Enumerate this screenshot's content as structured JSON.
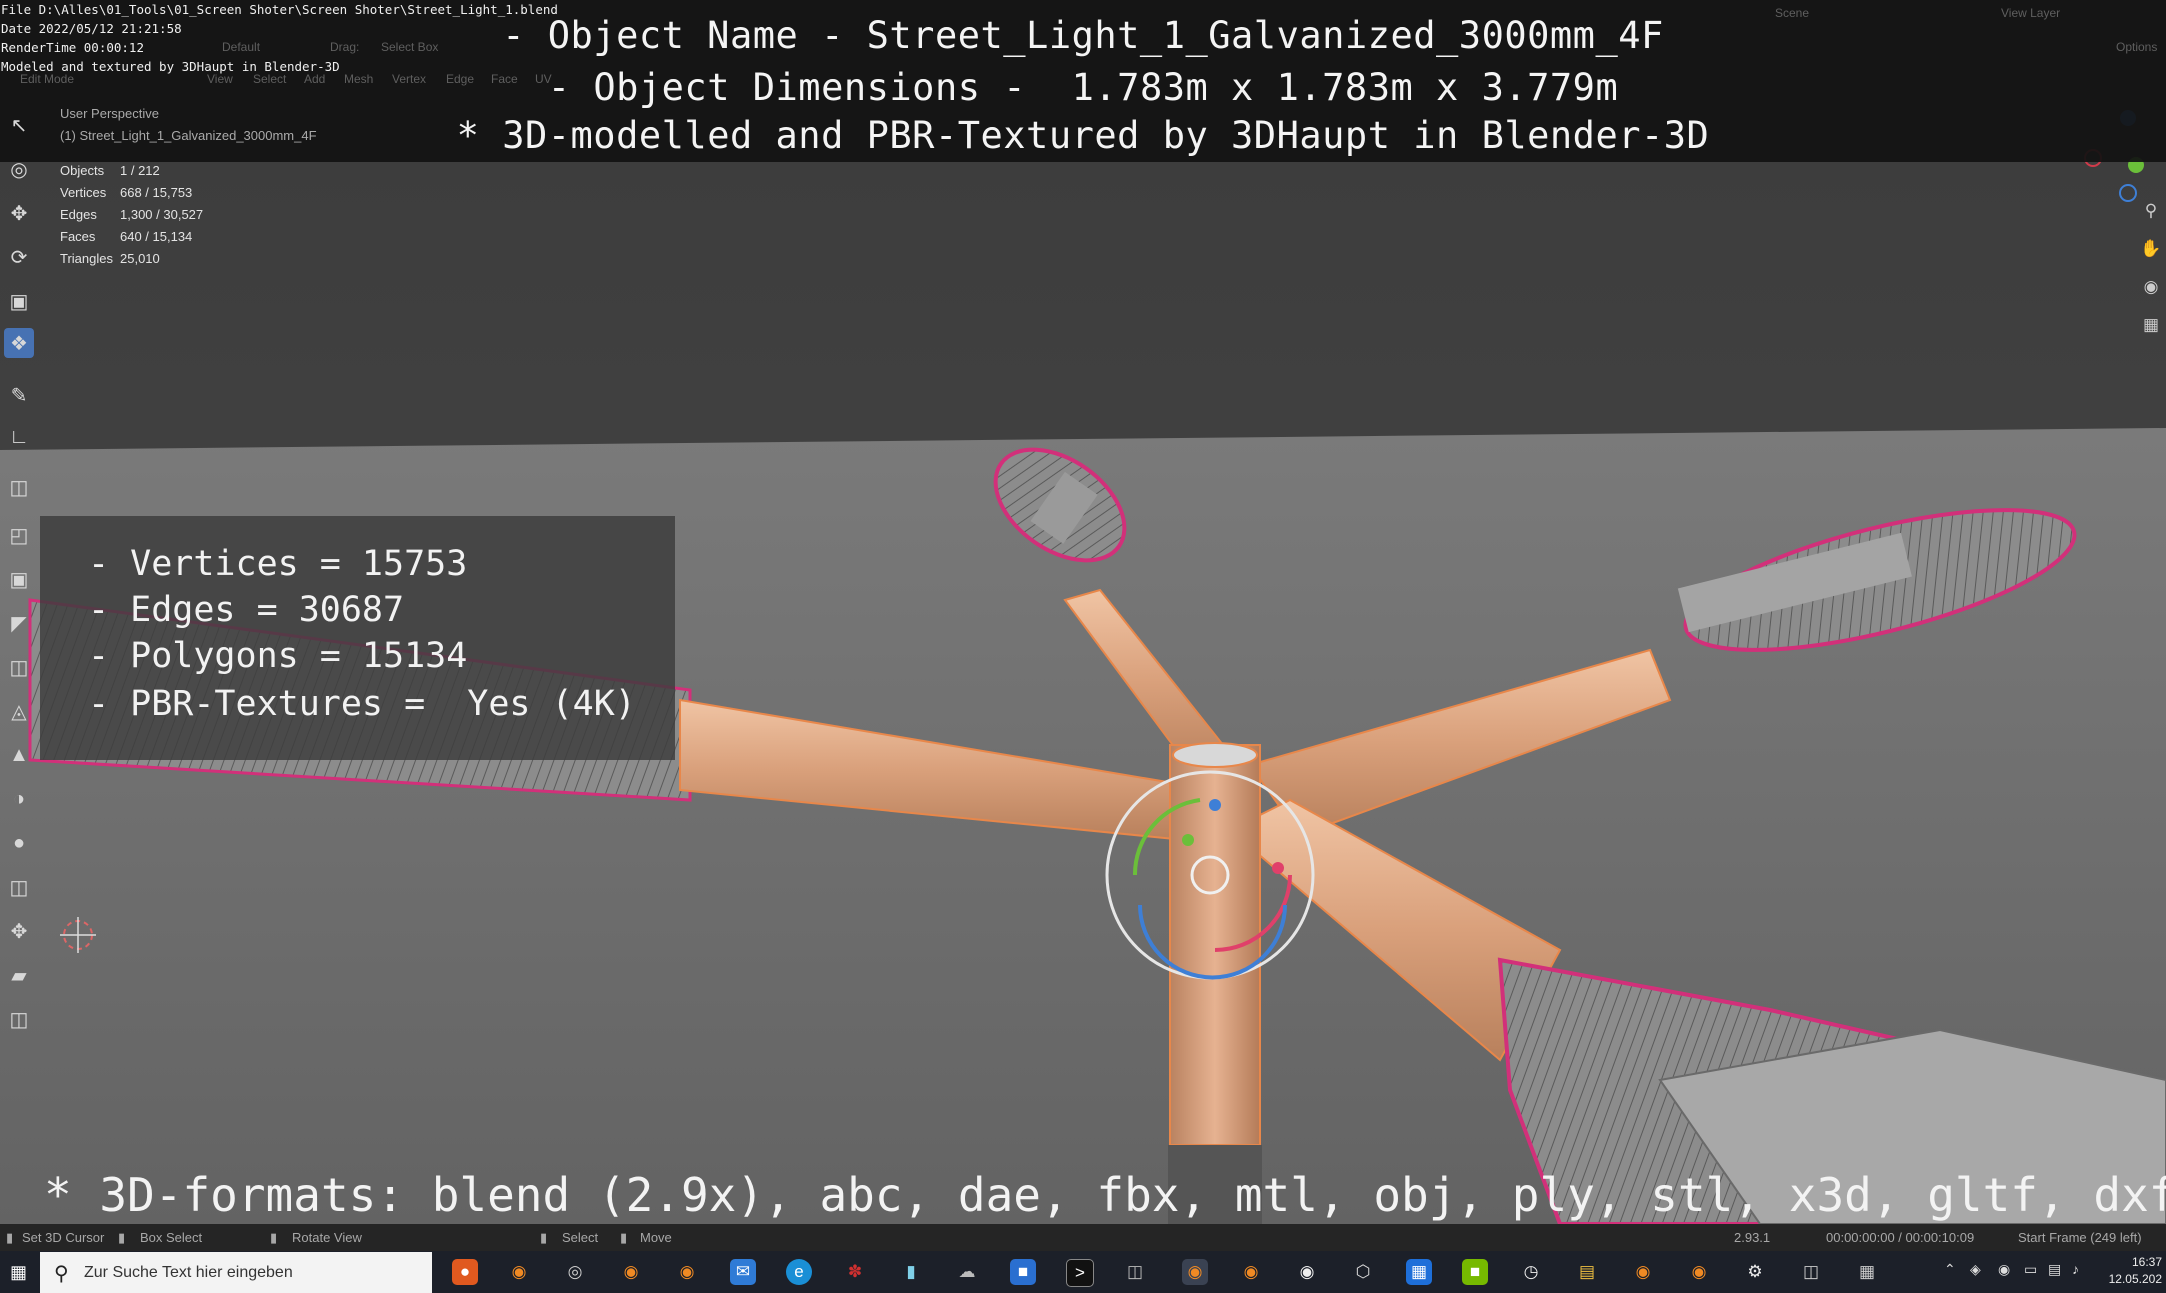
{
  "file_info": {
    "file_line": "File D:\\Alles\\01_Tools\\01_Screen Shoter\\Screen Shoter\\Street_Light_1.blend",
    "date_line": "Date 2022/05/12 21:21:58",
    "render_line": "RenderTime 00:00:12",
    "modeled_line": "Modeled and textured by 3DHaupt in Blender-3D"
  },
  "headline": {
    "object_name": "- Object Name - Street_Light_1_Galvanized_3000mm_4F",
    "object_dimensions": "- Object Dimensions -  1.783m x 1.783m x 3.779m",
    "credit": "* 3D-modelled and PBR-Textured by 3DHaupt in Blender-3D"
  },
  "header_faint": {
    "edit_mode": "Edit Mode",
    "view": "View",
    "select": "Select",
    "add": "Add",
    "mesh": "Mesh",
    "vertex": "Vertex",
    "edge": "Edge",
    "face": "Face",
    "uv": "UV",
    "default": "Default",
    "drag": "Drag:",
    "select_box": "Select Box",
    "scene": "Scene",
    "view_layer": "View Layer",
    "options": "Options"
  },
  "viewport": {
    "perspective": "User Perspective",
    "object_label": "(1) Street_Light_1_Galvanized_3000mm_4F"
  },
  "stats": [
    {
      "label": "Objects",
      "value": "1 / 212"
    },
    {
      "label": "Vertices",
      "value": "668 / 15,753"
    },
    {
      "label": "Edges",
      "value": "1,300 / 30,527"
    },
    {
      "label": "Faces",
      "value": "640 / 15,134"
    },
    {
      "label": "Triangles",
      "value": "25,010"
    }
  ],
  "info_box": [
    "- Vertices = 15753",
    "- Edges = 30687",
    "- Polygons = 15134",
    "- PBR-Textures =  Yes (4K)"
  ],
  "formats_line": "* 3D-formats: blend (2.9x), abc, dae, fbx, mtl, obj, ply, stl, x3d, gltf, dxf",
  "statusbar": {
    "set_cursor": "Set 3D Cursor",
    "box_select": "Box Select",
    "rotate_view": "Rotate View",
    "select": "Select",
    "move": "Move",
    "version": "2.93.1",
    "timecode": "00:00:00:00 / 00:00:10:09",
    "start_frame": "Start Frame (249 left)"
  },
  "taskbar": {
    "search_placeholder": "Zur Suche Text hier eingeben",
    "time": "16:37",
    "date": "12.05.202"
  },
  "toolbar_icons": [
    "select-icon",
    "cursor-icon",
    "move-icon",
    "rotate-icon",
    "scale-icon",
    "transform-icon",
    "annotate-icon",
    "measure-icon",
    "add-cube-icon",
    "extrude-icon",
    "inset-icon",
    "bevel-icon",
    "loop-cut-icon",
    "knife-icon",
    "poly-build-icon",
    "spin-icon",
    "smooth-icon",
    "edge-slide-icon",
    "shrink-icon",
    "shear-icon",
    "rip-icon"
  ],
  "colors": {
    "edit_orange": "#e8874a",
    "seam_magenta": "#d2307a",
    "active_blue": "#4772b3",
    "taskbar": "#1c2029"
  }
}
